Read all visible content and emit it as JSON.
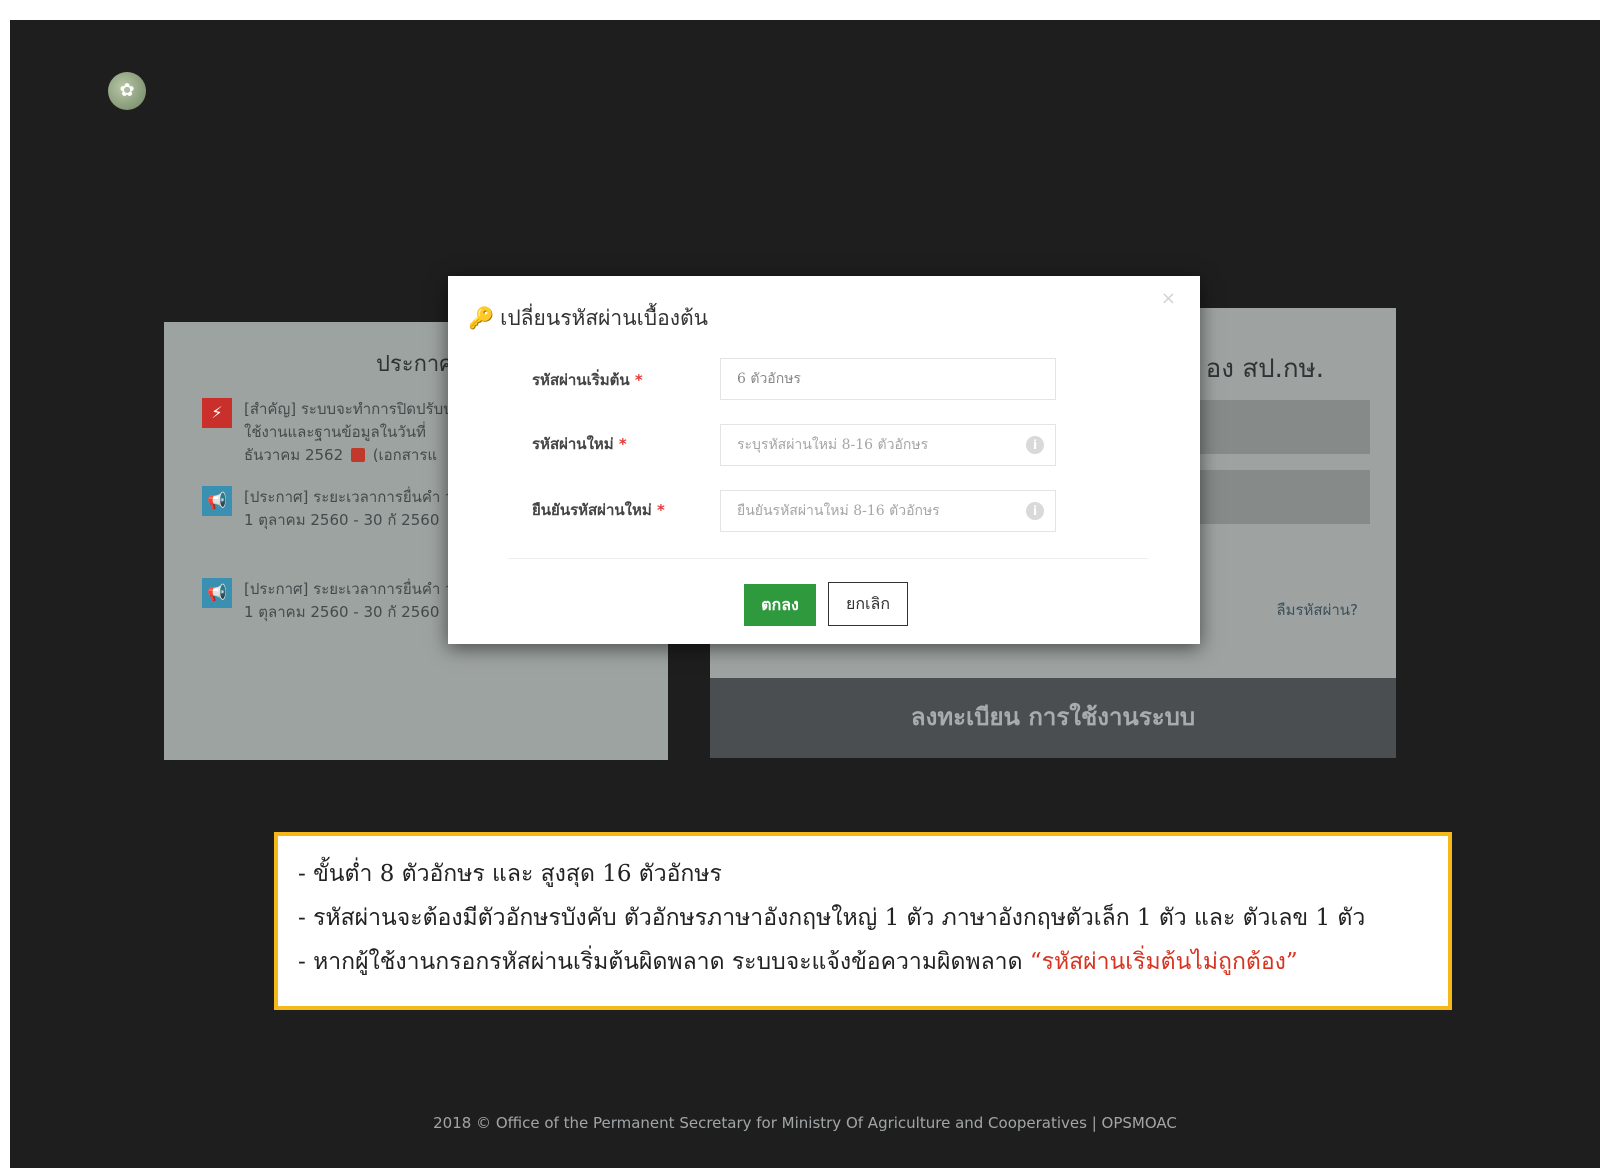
{
  "logo": {
    "icon": "seal-logo-icon"
  },
  "announcements": {
    "title": "ประกาศ",
    "items": [
      {
        "icon": "alert-icon",
        "color": "#c9302c",
        "text": "[สำคัญ] ระบบจะทำการปิดปรับปรุง ใช้งานและฐานข้อมูลในวันที่ ธันวาคม 2562",
        "doc": "(เอกสารแ"
      },
      {
        "icon": "megaphone-icon",
        "color": "#3a90b0",
        "text": "[ประกาศ] ระยะเวลาการยื่นคำ วันที่ 1 ตุลาคม 2560 - 30 กั 2560"
      },
      {
        "icon": "megaphone-icon",
        "color": "#3a90b0",
        "text": "[ประกาศ] ระยะเวลาการยื่นคำ วันที่ 1 ตุลาคม 2560 - 30 กั 2560"
      }
    ]
  },
  "login": {
    "title": "อง สป.กษ.",
    "forgot_label": "ลืมรหัสผ่าน?",
    "register_label": "ลงทะเบียน การใช้งานระบบ"
  },
  "modal": {
    "title": "เปลี่ยนรหัสผ่านเบื้องต้น",
    "close_glyph": "×",
    "fields": [
      {
        "label": "รหัสผ่านเริ่มต้น",
        "required": "*",
        "value": "6 ตัวอักษร"
      },
      {
        "label": "รหัสผ่านใหม่",
        "required": "*",
        "placeholder": "ระบุรหัสผ่านใหม่ 8-16 ตัวอักษร"
      },
      {
        "label": "ยืนยันรหัสผ่านใหม่",
        "required": "*",
        "placeholder": "ยืนยันรหัสผ่านใหม่ 8-16 ตัวอักษร"
      }
    ],
    "ok_label": "ตกลง",
    "cancel_label": "ยกเลิก"
  },
  "note": {
    "line1": "- ขั้นต่ำ 8 ตัวอักษร และ สูงสุด 16 ตัวอักษร",
    "line2": "- รหัสผ่านจะต้องมีตัวอักษรบังคับ ตัวอักษรภาษาอังกฤษใหญ่ 1 ตัว ภาษาอังกฤษตัวเล็ก 1 ตัว และ ตัวเลข 1 ตัว",
    "line3_prefix": "- หากผู้ใช้งานกรอกรหัสผ่านเริ่มต้นผิดพลาด ระบบจะแจ้งข้อความผิดพลาด",
    "line3_error": "“รหัสผ่านเริ่มต้นไม่ถูกต้อง”"
  },
  "footer": {
    "text": "2018 © Office of the Permanent Secretary for Ministry Of Agriculture and Cooperatives  |  OPSMOAC"
  }
}
